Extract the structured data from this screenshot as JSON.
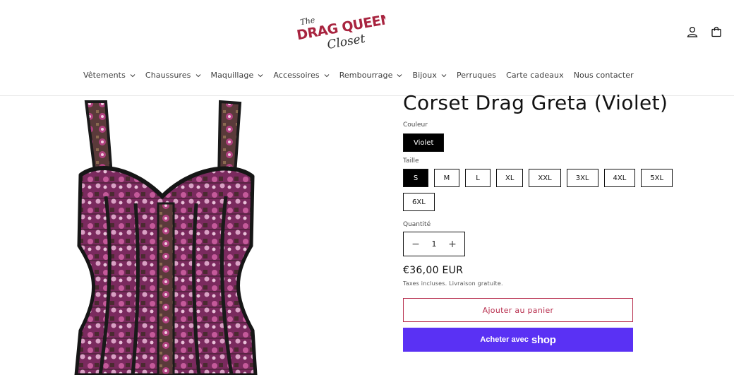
{
  "header": {
    "logo": {
      "line1": "The",
      "line2": "DRAG QUEEN",
      "line3": "Closet"
    },
    "account_icon": "user-icon",
    "cart_icon": "bag-icon"
  },
  "nav": [
    {
      "label": "Vêtements",
      "has_dropdown": true
    },
    {
      "label": "Chaussures",
      "has_dropdown": true
    },
    {
      "label": "Maquillage",
      "has_dropdown": true
    },
    {
      "label": "Accessoires",
      "has_dropdown": true
    },
    {
      "label": "Rembourrage",
      "has_dropdown": true
    },
    {
      "label": "Bijoux",
      "has_dropdown": true
    },
    {
      "label": "Perruques",
      "has_dropdown": false
    },
    {
      "label": "Carte cadeaux",
      "has_dropdown": false
    },
    {
      "label": "Nous contacter",
      "has_dropdown": false
    }
  ],
  "product": {
    "title": "Corset Drag Greta (Violet)",
    "color_label": "Couleur",
    "colors": [
      {
        "label": "Violet",
        "selected": true
      }
    ],
    "size_label": "Taille",
    "sizes": [
      {
        "label": "S",
        "selected": true
      },
      {
        "label": "M",
        "selected": false
      },
      {
        "label": "L",
        "selected": false
      },
      {
        "label": "XL",
        "selected": false
      },
      {
        "label": "XXL",
        "selected": false
      },
      {
        "label": "3XL",
        "selected": false
      },
      {
        "label": "4XL",
        "selected": false
      },
      {
        "label": "5XL",
        "selected": false
      },
      {
        "label": "6XL",
        "selected": false
      }
    ],
    "quantity_label": "Quantité",
    "quantity": "1",
    "price": "€36,00 EUR",
    "tax_note": "Taxes incluses. Livraison gratuite.",
    "add_to_cart": "Ajouter au panier",
    "buy_prefix": "Acheter avec",
    "buy_brand": "shop"
  },
  "colors": {
    "accent": "#b8304f",
    "shop_pay": "#5a31f4",
    "selected_swatch": "#000000"
  }
}
